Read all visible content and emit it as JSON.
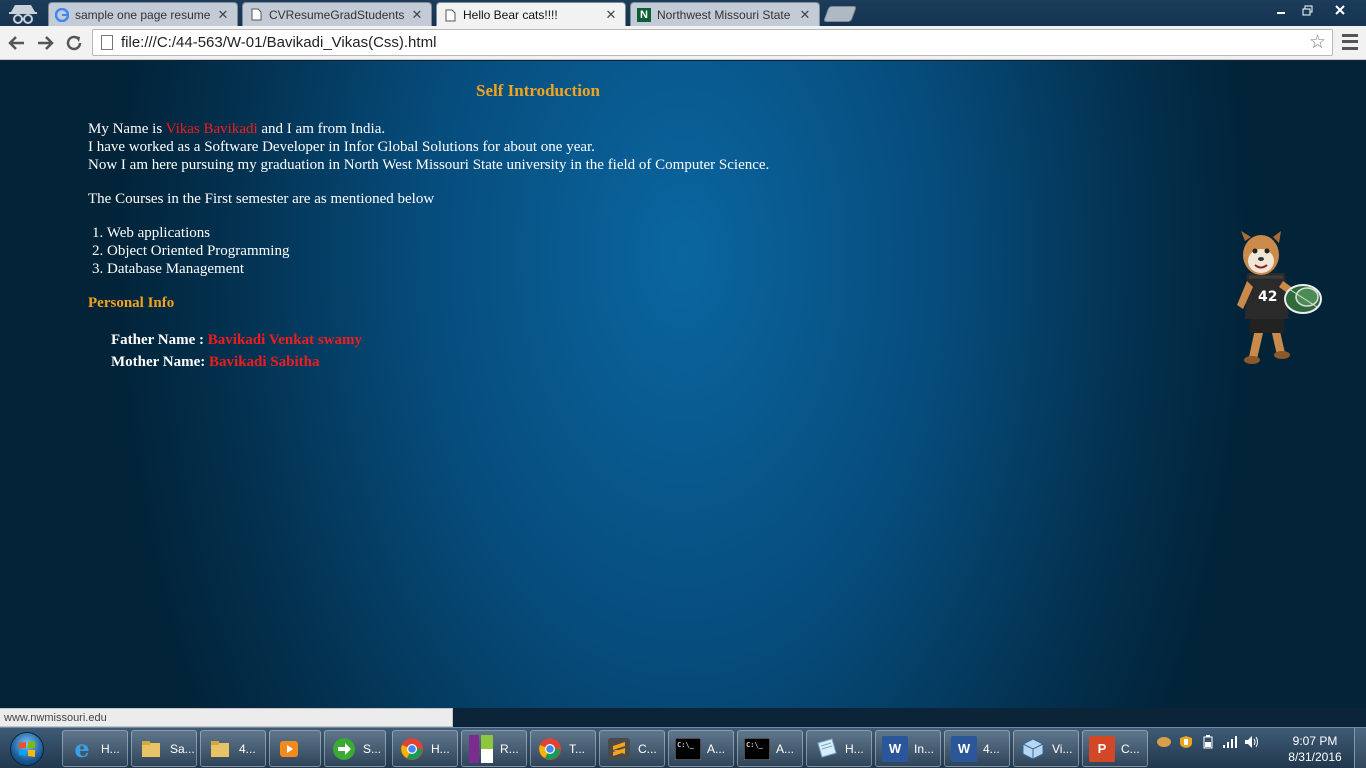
{
  "browser": {
    "tabs": [
      {
        "title": "sample one page resume",
        "favicon": "google-icon",
        "active": false
      },
      {
        "title": "CVResumeGradStudents",
        "favicon": "page-icon",
        "active": false
      },
      {
        "title": "Hello Bear cats!!!!",
        "favicon": "page-icon",
        "active": true
      },
      {
        "title": "Northwest Missouri State",
        "favicon": "northwest-icon",
        "active": false
      }
    ],
    "close_glyph": "✕",
    "url": "file:///C:/44-563/W-01/Bavikadi_Vikas(Css).html",
    "status_url": "www.nwmissouri.edu"
  },
  "page": {
    "title": "Self Introduction",
    "intro_prefix": "My Name is ",
    "name": "Vikas Bavikadi",
    "intro_suffix": " and I am from India.",
    "line2": "I have worked as a Software Developer in Infor Global Solutions for about one year.",
    "line3": "Now I am here pursuing my graduation in North West Missouri State university in the field of Computer Science.",
    "courses_intro": "The Courses in the First semester are as mentioned below",
    "courses": [
      {
        "num": "1.",
        "name": "Web applications"
      },
      {
        "num": "2.",
        "name": "Object Oriented Programming"
      },
      {
        "num": "3.",
        "name": "Database Management"
      }
    ],
    "personal_title": "Personal Info",
    "father_label": "Father Name",
    "father_sep": " : ",
    "father_value": "Bavikadi Venkat swamy",
    "mother_label": "Mother Name",
    "mother_sep": ": ",
    "mother_value": "Bavikadi Sabitha",
    "mascot_jersey": "42"
  },
  "taskbar": {
    "items": [
      {
        "icon": "internet-explorer-icon",
        "label": "H..."
      },
      {
        "icon": "folder-icon",
        "label": "Sa..."
      },
      {
        "icon": "folder-icon",
        "label": "4..."
      },
      {
        "icon": "media-player-icon",
        "label": ""
      },
      {
        "icon": "arrow-app-icon",
        "label": "S..."
      },
      {
        "icon": "chrome-icon",
        "label": "H..."
      },
      {
        "icon": "onenote-icon",
        "label": "R..."
      },
      {
        "icon": "chrome-icon",
        "label": "T..."
      },
      {
        "icon": "sublime-text-icon",
        "label": "C..."
      },
      {
        "icon": "command-prompt-icon",
        "label": "A..."
      },
      {
        "icon": "command-prompt-icon",
        "label": "A..."
      },
      {
        "icon": "notepad-icon",
        "label": "H..."
      },
      {
        "icon": "word-icon",
        "label": "In..."
      },
      {
        "icon": "word-icon",
        "label": "4..."
      },
      {
        "icon": "virtualbox-icon",
        "label": "Vi..."
      },
      {
        "icon": "powerpoint-icon",
        "label": "C..."
      }
    ],
    "time": "9:07 PM",
    "date": "8/31/2016"
  },
  "colors": {
    "accent_orange": "#f2a41f",
    "name_red": "#f31c1c",
    "page_bg": "#064c7c"
  }
}
